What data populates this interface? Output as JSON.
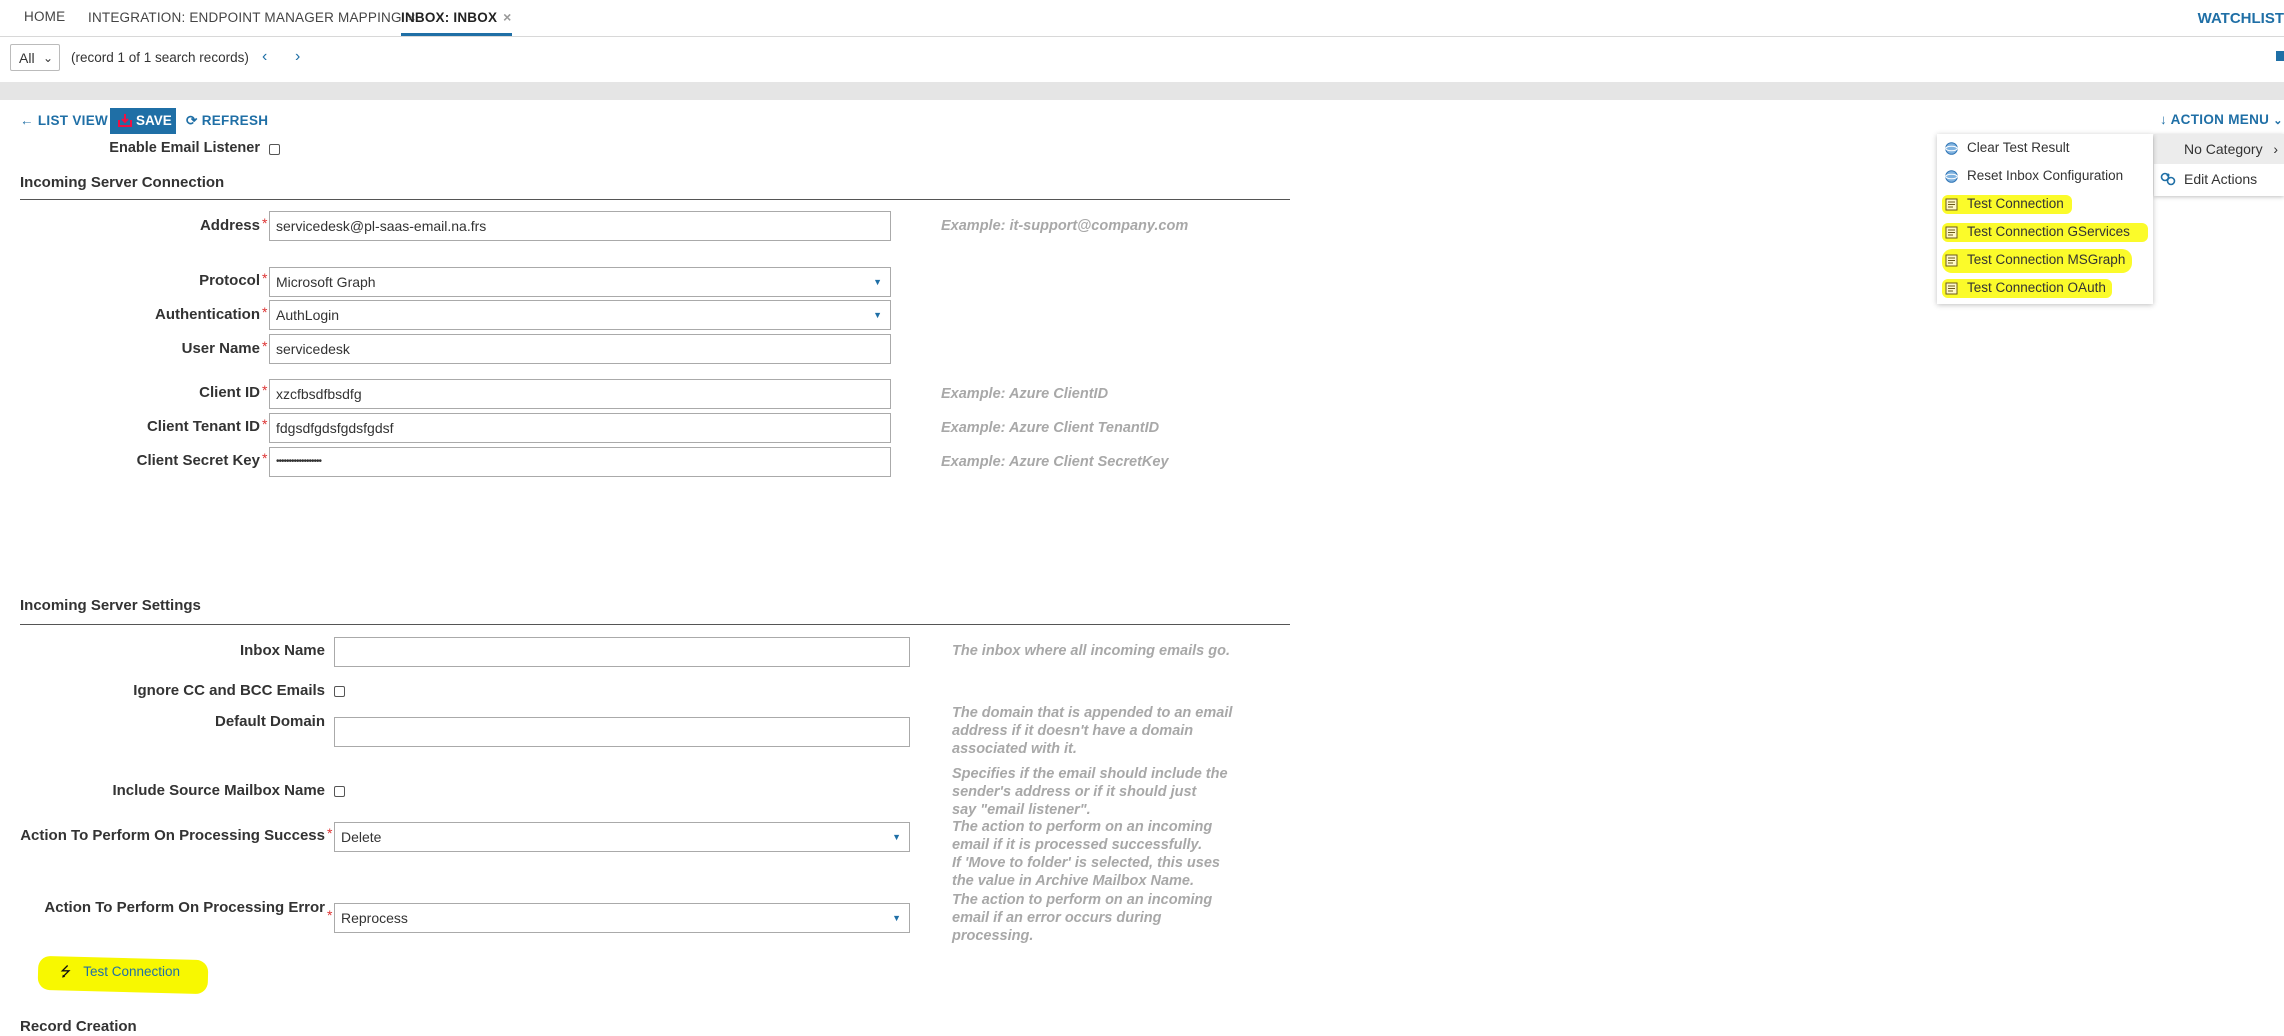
{
  "tabs": [
    {
      "label": "HOME",
      "closable": false
    },
    {
      "label": "INTEGRATION: ENDPOINT MANAGER MAPPING",
      "closable": true
    },
    {
      "label": "INBOX: INBOX",
      "closable": true,
      "active": true
    }
  ],
  "tab_close_glyph": "×",
  "watchlist_label": "WATCHLIST",
  "record_nav": {
    "filter_value": "All",
    "record_info": "(record 1 of 1 search records)"
  },
  "toolbar": {
    "list_view": "LIST VIEW",
    "save": "SAVE",
    "refresh": "REFRESH"
  },
  "enable_email_listener": {
    "label": "Enable Email Listener",
    "checked": false
  },
  "incoming_connection": {
    "title": "Incoming Server Connection",
    "fields": {
      "address": {
        "label": "Address",
        "value": "servicedesk@pl-saas-email.na.frs",
        "hint": "Example: it-support@company.com"
      },
      "protocol": {
        "label": "Protocol",
        "value": "Microsoft Graph"
      },
      "authentication": {
        "label": "Authentication",
        "value": "AuthLogin"
      },
      "user_name": {
        "label": "User Name",
        "value": "servicedesk"
      },
      "client_id": {
        "label": "Client ID",
        "value": "xzcfbsdfbsdfg",
        "hint": "Example: Azure ClientID"
      },
      "client_tenant_id": {
        "label": "Client Tenant ID",
        "value": "fdgsdfgdsfgdsfgdsf",
        "hint": "Example: Azure Client TenantID"
      },
      "client_secret_key": {
        "label": "Client Secret Key",
        "value": "••••••••••••••••••",
        "hint": "Example: Azure Client SecretKey"
      }
    }
  },
  "incoming_settings": {
    "title": "Incoming Server Settings",
    "fields": {
      "inbox_name": {
        "label": "Inbox Name",
        "value": "",
        "hint": "The inbox where all incoming emails go."
      },
      "ignore_cc": {
        "label": "Ignore CC and BCC Emails",
        "checked": false
      },
      "default_domain": {
        "label": "Default Domain",
        "value": "",
        "hint": [
          "The domain that is appended to an email",
          "address if it doesn't have a domain",
          "associated with it."
        ]
      },
      "include_source": {
        "label": "Include Source Mailbox Name",
        "checked": false,
        "hint": [
          "Specifies if the email should include the",
          "sender's address or if it should just",
          "say \"email listener\"."
        ]
      },
      "on_success": {
        "label": "Action To Perform On Processing Success",
        "value": "Delete",
        "hint": [
          "The action to perform on an incoming",
          "email if it is processed successfully.",
          "If 'Move to folder' is selected, this uses",
          "the value in Archive Mailbox Name."
        ]
      },
      "on_error": {
        "label": "Action To Perform On Processing Error",
        "value": "Reprocess",
        "hint": [
          "The action to perform on an incoming",
          "email if an error occurs during",
          "processing."
        ]
      }
    }
  },
  "test_connection_button": "Test Connection",
  "record_creation_title": "Record Creation",
  "action_menu": {
    "title": "ACTION MENU",
    "category": "No Category",
    "edit_actions": "Edit Actions",
    "items": [
      {
        "label": "Clear Test Result",
        "icon": "globe-icon",
        "highlighted": false
      },
      {
        "label": "Reset Inbox Configuration",
        "icon": "globe-icon",
        "highlighted": false
      },
      {
        "label": "Test Connection",
        "icon": "script-icon",
        "highlighted": true
      },
      {
        "label": "Test Connection GServices",
        "icon": "script-icon",
        "highlighted": true
      },
      {
        "label": "Test Connection MSGraph",
        "icon": "script-icon",
        "highlighted": true
      },
      {
        "label": "Test Connection OAuth",
        "icon": "script-icon",
        "highlighted": true
      }
    ]
  },
  "colors": {
    "accent": "#1f6fa6",
    "required": "#dd3333",
    "highlight": "#fbfb2a",
    "hint": "#a8a8a8"
  }
}
